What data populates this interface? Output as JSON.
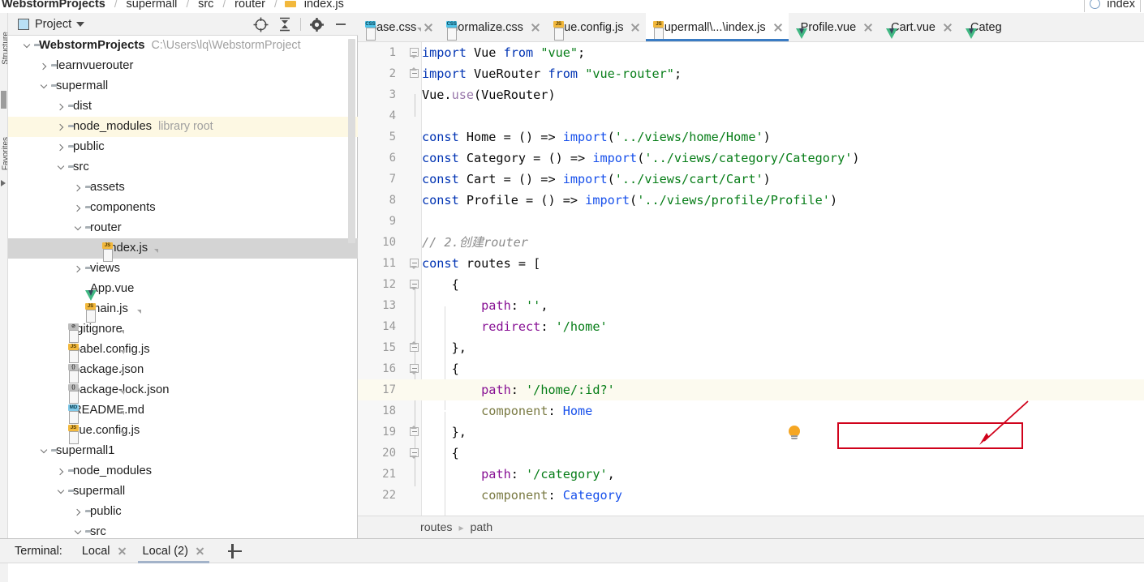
{
  "breadcrumb": {
    "items": [
      "WebstormProjects",
      "supermall",
      "src",
      "router",
      "index.js"
    ],
    "right_chip": "index"
  },
  "project_panel": {
    "title": "Project",
    "tools": [
      {
        "name": "locate-icon",
        "label": "Select Opened File"
      },
      {
        "name": "collapse-all-icon",
        "label": "Collapse All"
      },
      {
        "name": "gear-icon",
        "label": "Settings"
      },
      {
        "name": "minimize-icon",
        "label": "Hide"
      }
    ],
    "tree": [
      {
        "label": "WebstormProjects",
        "hint": "C:\\Users\\lq\\WebstormProject",
        "indent": 0,
        "twisty": "down",
        "icon": "folder",
        "bold": true,
        "state": "normal"
      },
      {
        "label": "learnvuerouter",
        "hint": "",
        "indent": 1,
        "twisty": "right",
        "icon": "folder",
        "bold": false,
        "state": "normal"
      },
      {
        "label": "supermall",
        "hint": "",
        "indent": 1,
        "twisty": "down",
        "icon": "folder",
        "bold": false,
        "state": "normal"
      },
      {
        "label": "dist",
        "hint": "",
        "indent": 2,
        "twisty": "right",
        "icon": "folder",
        "bold": false,
        "state": "normal"
      },
      {
        "label": "node_modules",
        "hint": "library root",
        "indent": 2,
        "twisty": "right",
        "icon": "folder",
        "bold": false,
        "state": "highlight"
      },
      {
        "label": "public",
        "hint": "",
        "indent": 2,
        "twisty": "right",
        "icon": "folder",
        "bold": false,
        "state": "normal"
      },
      {
        "label": "src",
        "hint": "",
        "indent": 2,
        "twisty": "down",
        "icon": "folder",
        "bold": false,
        "state": "normal"
      },
      {
        "label": "assets",
        "hint": "",
        "indent": 3,
        "twisty": "right",
        "icon": "folder",
        "bold": false,
        "state": "normal"
      },
      {
        "label": "components",
        "hint": "",
        "indent": 3,
        "twisty": "right",
        "icon": "folder",
        "bold": false,
        "state": "normal"
      },
      {
        "label": "router",
        "hint": "",
        "indent": 3,
        "twisty": "down",
        "icon": "folder",
        "bold": false,
        "state": "normal"
      },
      {
        "label": "index.js",
        "hint": "",
        "indent": 4,
        "twisty": "none",
        "icon": "js",
        "bold": false,
        "state": "selected"
      },
      {
        "label": "views",
        "hint": "",
        "indent": 3,
        "twisty": "right",
        "icon": "folder",
        "bold": false,
        "state": "normal"
      },
      {
        "label": "App.vue",
        "hint": "",
        "indent": 3,
        "twisty": "none",
        "icon": "vue",
        "bold": false,
        "state": "normal"
      },
      {
        "label": "main.js",
        "hint": "",
        "indent": 3,
        "twisty": "none",
        "icon": "js",
        "bold": false,
        "state": "normal"
      },
      {
        "label": ".gitignore",
        "hint": "",
        "indent": 2,
        "twisty": "none",
        "icon": "gitignore",
        "bold": false,
        "state": "normal"
      },
      {
        "label": "babel.config.js",
        "hint": "",
        "indent": 2,
        "twisty": "none",
        "icon": "js",
        "bold": false,
        "state": "normal"
      },
      {
        "label": "package.json",
        "hint": "",
        "indent": 2,
        "twisty": "none",
        "icon": "json",
        "bold": false,
        "state": "normal"
      },
      {
        "label": "package-lock.json",
        "hint": "",
        "indent": 2,
        "twisty": "none",
        "icon": "json",
        "bold": false,
        "state": "normal"
      },
      {
        "label": "README.md",
        "hint": "",
        "indent": 2,
        "twisty": "none",
        "icon": "md",
        "bold": false,
        "state": "normal"
      },
      {
        "label": "vue.config.js",
        "hint": "",
        "indent": 2,
        "twisty": "none",
        "icon": "js",
        "bold": false,
        "state": "normal"
      },
      {
        "label": "supermall1",
        "hint": "",
        "indent": 1,
        "twisty": "down",
        "icon": "folder",
        "bold": false,
        "state": "normal"
      },
      {
        "label": "node_modules",
        "hint": "",
        "indent": 2,
        "twisty": "right",
        "icon": "folder",
        "bold": false,
        "state": "normal"
      },
      {
        "label": "supermall",
        "hint": "",
        "indent": 2,
        "twisty": "down",
        "icon": "folder",
        "bold": false,
        "state": "normal"
      },
      {
        "label": "public",
        "hint": "",
        "indent": 3,
        "twisty": "right",
        "icon": "folder",
        "bold": false,
        "state": "normal"
      },
      {
        "label": "src",
        "hint": "",
        "indent": 3,
        "twisty": "down",
        "icon": "folder",
        "bold": false,
        "state": "normal"
      }
    ]
  },
  "editor": {
    "tabs": [
      {
        "label": "base.css",
        "icon": "css",
        "active": false
      },
      {
        "label": "normalize.css",
        "icon": "css",
        "active": false
      },
      {
        "label": "vue.config.js",
        "icon": "js",
        "active": false
      },
      {
        "label": "supermall\\...\\index.js",
        "icon": "js",
        "active": true
      },
      {
        "label": "Profile.vue",
        "icon": "vue",
        "active": false
      },
      {
        "label": "Cart.vue",
        "icon": "vue",
        "active": false
      },
      {
        "label": "Categ",
        "icon": "vue",
        "active": false
      }
    ],
    "code_lines": [
      {
        "n": 1,
        "fold": "open",
        "hl": false,
        "tokens": [
          {
            "t": "import",
            "c": "kw"
          },
          {
            "t": " Vue ",
            "c": "plain"
          },
          {
            "t": "from",
            "c": "kw"
          },
          {
            "t": " ",
            "c": "plain"
          },
          {
            "t": "\"vue\"",
            "c": "str"
          },
          {
            "t": ";",
            "c": "plain"
          }
        ]
      },
      {
        "n": 2,
        "fold": "close",
        "hl": false,
        "tokens": [
          {
            "t": "import",
            "c": "kw"
          },
          {
            "t": " VueRouter ",
            "c": "plain"
          },
          {
            "t": "from",
            "c": "kw"
          },
          {
            "t": " ",
            "c": "plain"
          },
          {
            "t": "\"vue-router\"",
            "c": "str"
          },
          {
            "t": ";",
            "c": "plain"
          }
        ]
      },
      {
        "n": 3,
        "fold": "",
        "hl": false,
        "tokens": [
          {
            "t": "Vue.",
            "c": "plain"
          },
          {
            "t": "use",
            "c": "meth"
          },
          {
            "t": "(VueRouter)",
            "c": "plain"
          }
        ]
      },
      {
        "n": 4,
        "fold": "",
        "hl": false,
        "tokens": []
      },
      {
        "n": 5,
        "fold": "",
        "hl": false,
        "tokens": [
          {
            "t": "const",
            "c": "kw"
          },
          {
            "t": " Home = () => ",
            "c": "plain"
          },
          {
            "t": "import",
            "c": "cls"
          },
          {
            "t": "(",
            "c": "plain"
          },
          {
            "t": "'../views/home/Home'",
            "c": "str"
          },
          {
            "t": ")",
            "c": "plain"
          }
        ]
      },
      {
        "n": 6,
        "fold": "",
        "hl": false,
        "tokens": [
          {
            "t": "const",
            "c": "kw"
          },
          {
            "t": " Category = () => ",
            "c": "plain"
          },
          {
            "t": "import",
            "c": "cls"
          },
          {
            "t": "(",
            "c": "plain"
          },
          {
            "t": "'../views/category/Category'",
            "c": "str"
          },
          {
            "t": ")",
            "c": "plain"
          }
        ]
      },
      {
        "n": 7,
        "fold": "",
        "hl": false,
        "tokens": [
          {
            "t": "const",
            "c": "kw"
          },
          {
            "t": " Cart = () => ",
            "c": "plain"
          },
          {
            "t": "import",
            "c": "cls"
          },
          {
            "t": "(",
            "c": "plain"
          },
          {
            "t": "'../views/cart/Cart'",
            "c": "str"
          },
          {
            "t": ")",
            "c": "plain"
          }
        ]
      },
      {
        "n": 8,
        "fold": "",
        "hl": false,
        "tokens": [
          {
            "t": "const",
            "c": "kw"
          },
          {
            "t": " Profile = () => ",
            "c": "plain"
          },
          {
            "t": "import",
            "c": "cls"
          },
          {
            "t": "(",
            "c": "plain"
          },
          {
            "t": "'../views/profile/Profile'",
            "c": "str"
          },
          {
            "t": ")",
            "c": "plain"
          }
        ]
      },
      {
        "n": 9,
        "fold": "",
        "hl": false,
        "tokens": []
      },
      {
        "n": 10,
        "fold": "",
        "hl": false,
        "tokens": [
          {
            "t": "// 2.创建router",
            "c": "cmt"
          }
        ]
      },
      {
        "n": 11,
        "fold": "open",
        "hl": false,
        "tokens": [
          {
            "t": "const",
            "c": "kw"
          },
          {
            "t": " routes = [",
            "c": "plain"
          }
        ]
      },
      {
        "n": 12,
        "fold": "open",
        "hl": false,
        "tokens": [
          {
            "t": "    {",
            "c": "plain"
          }
        ]
      },
      {
        "n": 13,
        "fold": "",
        "hl": false,
        "tokens": [
          {
            "t": "        ",
            "c": "plain"
          },
          {
            "t": "path",
            "c": "prop"
          },
          {
            "t": ": ",
            "c": "plain"
          },
          {
            "t": "''",
            "c": "str"
          },
          {
            "t": ",",
            "c": "plain"
          }
        ]
      },
      {
        "n": 14,
        "fold": "",
        "hl": false,
        "tokens": [
          {
            "t": "        ",
            "c": "plain"
          },
          {
            "t": "redirect",
            "c": "prop"
          },
          {
            "t": ": ",
            "c": "plain"
          },
          {
            "t": "'/home'",
            "c": "str"
          }
        ]
      },
      {
        "n": 15,
        "fold": "close",
        "hl": false,
        "tokens": [
          {
            "t": "    },",
            "c": "plain"
          }
        ]
      },
      {
        "n": 16,
        "fold": "open",
        "hl": false,
        "tokens": [
          {
            "t": "    {",
            "c": "plain"
          }
        ]
      },
      {
        "n": 17,
        "fold": "",
        "hl": true,
        "tokens": [
          {
            "t": "        ",
            "c": "plain"
          },
          {
            "t": "path",
            "c": "prop"
          },
          {
            "t": ": ",
            "c": "plain"
          },
          {
            "t": "'/home/:id?'",
            "c": "str"
          }
        ]
      },
      {
        "n": 18,
        "fold": "",
        "hl": false,
        "tokens": [
          {
            "t": "        ",
            "c": "plain"
          },
          {
            "t": "component",
            "c": "fn"
          },
          {
            "t": ": ",
            "c": "plain"
          },
          {
            "t": "Home",
            "c": "cls"
          }
        ]
      },
      {
        "n": 19,
        "fold": "close",
        "hl": false,
        "tokens": [
          {
            "t": "    },",
            "c": "plain"
          }
        ]
      },
      {
        "n": 20,
        "fold": "open",
        "hl": false,
        "tokens": [
          {
            "t": "    {",
            "c": "plain"
          }
        ]
      },
      {
        "n": 21,
        "fold": "",
        "hl": false,
        "tokens": [
          {
            "t": "        ",
            "c": "plain"
          },
          {
            "t": "path",
            "c": "prop"
          },
          {
            "t": ": ",
            "c": "plain"
          },
          {
            "t": "'/category'",
            "c": "str"
          },
          {
            "t": ",",
            "c": "plain"
          }
        ]
      },
      {
        "n": 22,
        "fold": "",
        "hl": false,
        "tokens": [
          {
            "t": "        ",
            "c": "plain"
          },
          {
            "t": "component",
            "c": "fn"
          },
          {
            "t": ": ",
            "c": "plain"
          },
          {
            "t": "Category",
            "c": "cls"
          }
        ]
      }
    ],
    "annotation": {
      "name": "red-highlight-box",
      "target_line": 17
    },
    "status_breadcrumb": [
      "routes",
      "path"
    ]
  },
  "terminal": {
    "label": "Terminal:",
    "tabs": [
      {
        "label": "Local",
        "active": false
      },
      {
        "label": "Local (2)",
        "active": true
      }
    ],
    "add_label": "+"
  },
  "colors": {
    "accent": "#3a7cc4",
    "annotation": "#d0021b",
    "highlight_row": "#fdf8e3",
    "selected_row": "#d4d4d4",
    "vue_green": "#41b883",
    "js_badge": "#f2b83c",
    "css_badge": "#4fc3e8"
  }
}
